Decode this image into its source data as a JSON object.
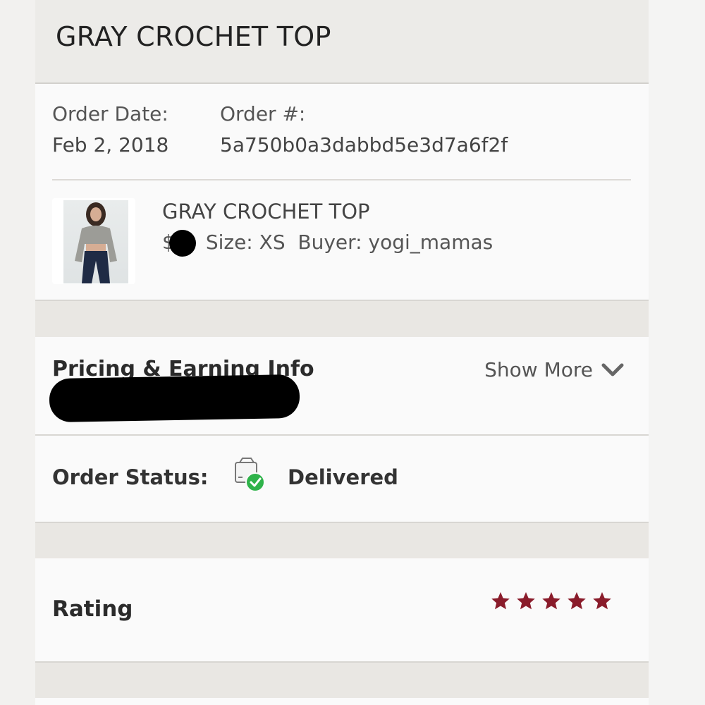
{
  "header": {
    "title": "GRAY CROCHET TOP"
  },
  "order": {
    "date_label": "Order Date:",
    "date_value": "Feb 2, 2018",
    "number_label": "Order #:",
    "number_value": "5a750b0a3dabbd5e3d7a6f2f"
  },
  "item": {
    "title": "GRAY CROCHET TOP",
    "price_prefix": "$",
    "size": "Size: XS",
    "buyer": "Buyer: yogi_mamas"
  },
  "pricing": {
    "title": "Pricing & Earning Info",
    "show_more_label": "Show More",
    "show_more_icon": "chevron-down-icon"
  },
  "status": {
    "label": "Order Status:",
    "value": "Delivered",
    "icon": "package-delivered-icon",
    "accent": "#2fb34a"
  },
  "rating": {
    "label": "Rating",
    "stars": 5,
    "star_color": "#8a1c2b"
  }
}
